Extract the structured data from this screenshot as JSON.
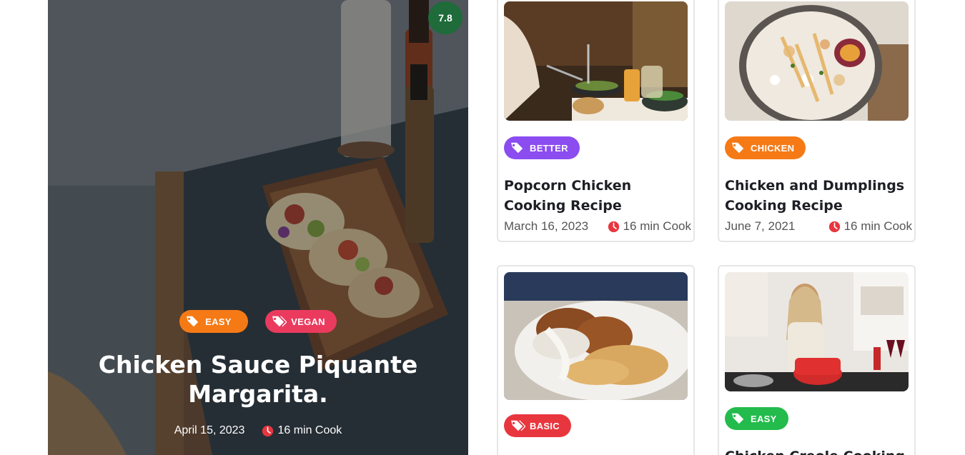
{
  "hero": {
    "rating": "7.8",
    "tags": [
      {
        "label": "EASY",
        "color": "#f57a16",
        "icon": "tag-icon"
      },
      {
        "label": "VEGAN",
        "color": "#ea3b5f",
        "icon": "tag-icon"
      }
    ],
    "title": "Chicken Sauce Piquante Margarita.",
    "date": "April 15, 2023",
    "cook_time": "16 min Cook"
  },
  "cards": [
    {
      "tag": {
        "label": "BETTER",
        "color": "#8b4cf0",
        "icon": "tag-icon"
      },
      "title": "Popcorn Chicken Cooking Recipe",
      "date": "March 16, 2023",
      "cook_time": "16 min Cook"
    },
    {
      "tag": {
        "label": "CHICKEN",
        "color": "#f57a16",
        "icon": "tag-icon"
      },
      "title": "Chicken and Dumplings Cooking Recipe",
      "date": "June 7, 2021",
      "cook_time": "16 min Cook"
    },
    {
      "tag": {
        "label": "BASIC",
        "color": "#e8363f",
        "icon": "tag-icon"
      },
      "title": "",
      "date": "",
      "cook_time": ""
    },
    {
      "tag": {
        "label": "EASY",
        "color": "#22bb4c",
        "icon": "tag-icon"
      },
      "title": "Chicken Creole Cooking",
      "date": "",
      "cook_time": ""
    }
  ],
  "colors": {
    "clock": "#e8363f",
    "rating_bg": "#1f6b3a"
  }
}
